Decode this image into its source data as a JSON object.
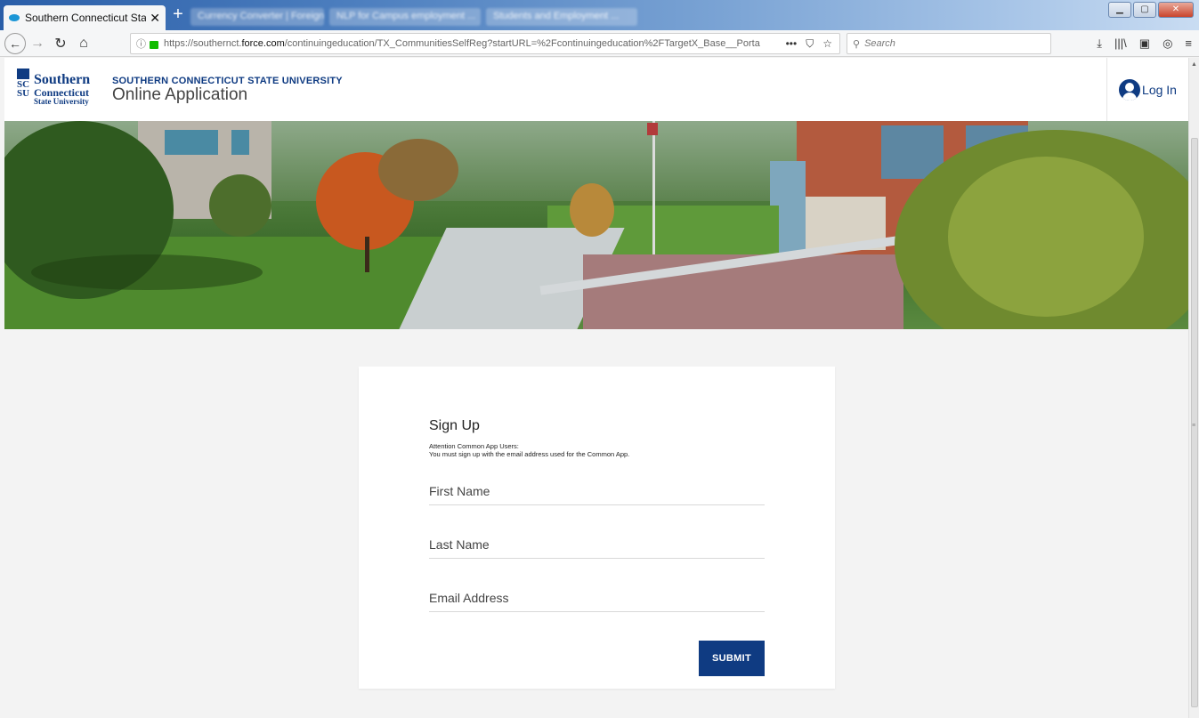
{
  "browser": {
    "active_tab_title": "Southern Connecticut State Uni",
    "blurred_tabs": [
      "Currency Converter | Foreign ...",
      "NLP for Campus employment ...",
      "Students and Employment ..."
    ],
    "url_prefix": "https://southernct.",
    "url_domain": "force.com",
    "url_rest": "/continuingeducation/TX_CommunitiesSelfReg?startURL=%2Fcontinuingeducation%2FTargetX_Base__Porta",
    "search_placeholder": "Search",
    "page_actions": [
      "•••",
      "⛉",
      "☆"
    ],
    "toolbar_icons": [
      "⤓",
      "|||\\",
      "▣",
      "◎",
      "≡"
    ]
  },
  "header": {
    "logo": {
      "line1": "Southern",
      "line2": "Connecticut",
      "line3": "State University",
      "monogram": [
        "SC",
        "SU"
      ]
    },
    "university_name": "SOUTHERN CONNECTICUT STATE UNIVERSITY",
    "app_title": "Online Application",
    "login_label": "Log In"
  },
  "form": {
    "title": "Sign Up",
    "note_line1": "Attention Common App Users:",
    "note_line2": "You must sign up with the email address used for the Common App.",
    "first_name_placeholder": "First Name",
    "last_name_placeholder": "Last Name",
    "email_placeholder": "Email Address",
    "submit_label": "SUBMIT"
  },
  "colors": {
    "brand": "#0f3b82",
    "background": "#f3f3f3"
  }
}
